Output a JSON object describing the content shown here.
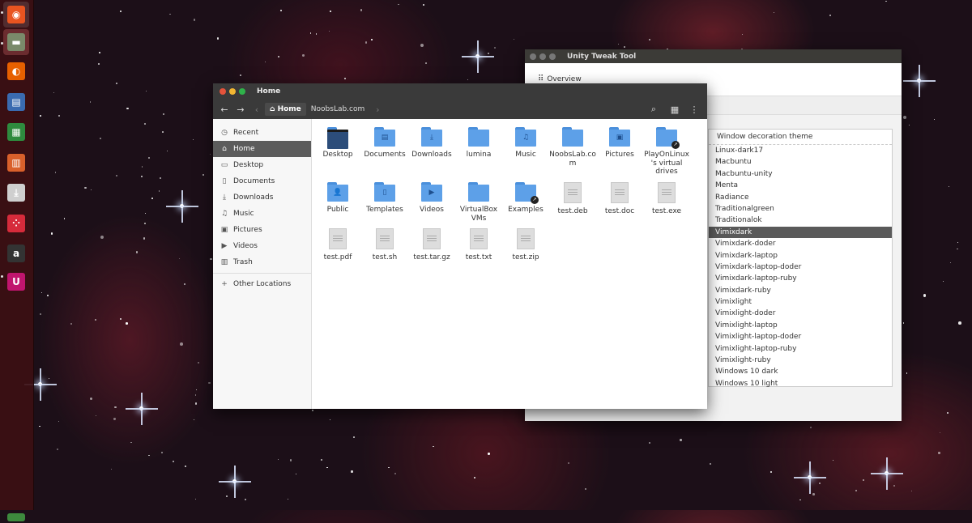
{
  "launcher": {
    "icons": [
      "ubuntu-dash-icon",
      "files-icon",
      "firefox-icon",
      "writer-icon",
      "calc-icon",
      "impress-icon",
      "software-center-icon",
      "dropbox-icon",
      "amazon-icon",
      "unity-tweak-icon",
      "trash-icon"
    ]
  },
  "tweak_window": {
    "title": "Unity Tweak Tool",
    "overview_label": "Overview",
    "theme_header": "Window decoration theme",
    "themes": [
      "Linux-dark17",
      "Macbuntu",
      "Macbuntu-unity",
      "Menta",
      "Radiance",
      "Traditionalgreen",
      "Traditionalok",
      "Vimixdark",
      "Vimixdark-doder",
      "Vimixdark-laptop",
      "Vimixdark-laptop-doder",
      "Vimixdark-laptop-ruby",
      "Vimixdark-ruby",
      "Vimixlight",
      "Vimixlight-doder",
      "Vimixlight-laptop",
      "Vimixlight-laptop-doder",
      "Vimixlight-laptop-ruby",
      "Vimixlight-ruby",
      "Windows 10 dark",
      "Windows 10 light"
    ],
    "selected_theme": "Vimixdark"
  },
  "files_window": {
    "title": "Home",
    "breadcrumbs": [
      "Home",
      "NoobsLab.com"
    ],
    "sidebar": [
      {
        "label": "Recent",
        "icon": "clock-icon"
      },
      {
        "label": "Home",
        "icon": "home-icon",
        "selected": true
      },
      {
        "label": "Desktop",
        "icon": "desktop-icon"
      },
      {
        "label": "Documents",
        "icon": "document-icon"
      },
      {
        "label": "Downloads",
        "icon": "download-icon"
      },
      {
        "label": "Music",
        "icon": "music-icon"
      },
      {
        "label": "Pictures",
        "icon": "picture-icon"
      },
      {
        "label": "Videos",
        "icon": "video-icon"
      },
      {
        "label": "Trash",
        "icon": "trash-icon"
      }
    ],
    "other_locations": "Other Locations",
    "items": [
      {
        "name": "Desktop",
        "kind": "folder-dark"
      },
      {
        "name": "Documents",
        "kind": "folder",
        "glyph": "▤"
      },
      {
        "name": "Downloads",
        "kind": "folder",
        "glyph": "⤓"
      },
      {
        "name": "lumina",
        "kind": "folder"
      },
      {
        "name": "Music",
        "kind": "folder",
        "glyph": "♫"
      },
      {
        "name": "NoobsLab.com",
        "kind": "folder"
      },
      {
        "name": "Pictures",
        "kind": "folder",
        "glyph": "▣"
      },
      {
        "name": "PlayOnLinux's virtual drives",
        "kind": "folder-link"
      },
      {
        "name": "Public",
        "kind": "folder",
        "glyph": "👤"
      },
      {
        "name": "Templates",
        "kind": "folder",
        "glyph": "▯"
      },
      {
        "name": "Videos",
        "kind": "folder",
        "glyph": "▶"
      },
      {
        "name": "VirtualBox VMs",
        "kind": "folder"
      },
      {
        "name": "Examples",
        "kind": "folder-link"
      },
      {
        "name": "test.deb",
        "kind": "doc"
      },
      {
        "name": "test.doc",
        "kind": "doc"
      },
      {
        "name": "test.exe",
        "kind": "doc"
      },
      {
        "name": "test.pdf",
        "kind": "doc"
      },
      {
        "name": "test.sh",
        "kind": "doc"
      },
      {
        "name": "test.tar.gz",
        "kind": "doc"
      },
      {
        "name": "test.txt",
        "kind": "doc"
      },
      {
        "name": "test.zip",
        "kind": "doc"
      }
    ]
  },
  "colors": {
    "close": "#e4533b",
    "minimize": "#f2b632",
    "maximize": "#2fb24a",
    "launcher_bg": "#3c0f14",
    "titlebar": "#3a3a3a"
  }
}
